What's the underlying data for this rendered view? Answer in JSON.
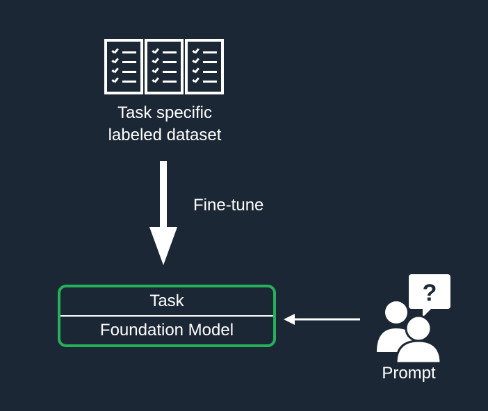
{
  "dataset": {
    "label_line1": "Task specific",
    "label_line2": "labeled dataset"
  },
  "arrow": {
    "finetune_label": "Fine-tune"
  },
  "model": {
    "task_label": "Task",
    "foundation_label": "Foundation Model"
  },
  "prompt": {
    "label": "Prompt"
  },
  "colors": {
    "background": "#1c2735",
    "foreground": "#ffffff",
    "accent": "#27b05a"
  },
  "icons": {
    "documents": "checklist-documents-icon",
    "arrow_down": "arrow-down-icon",
    "arrow_left": "arrow-left-icon",
    "prompt": "user-question-icon"
  }
}
